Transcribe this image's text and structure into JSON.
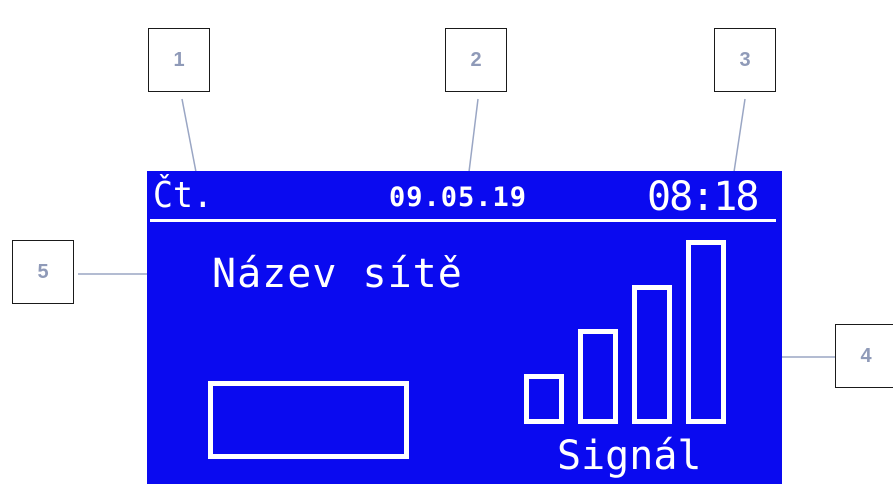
{
  "callouts": [
    "1",
    "2",
    "3",
    "4",
    "5"
  ],
  "display": {
    "background_color": "#0a0af0",
    "day": "Čt.",
    "date": "09.05.19",
    "time": "08:18",
    "network_name": "Název sítě",
    "signal_label": "Signál",
    "signal_bars_total": 4,
    "signal_bars_active": 4
  }
}
